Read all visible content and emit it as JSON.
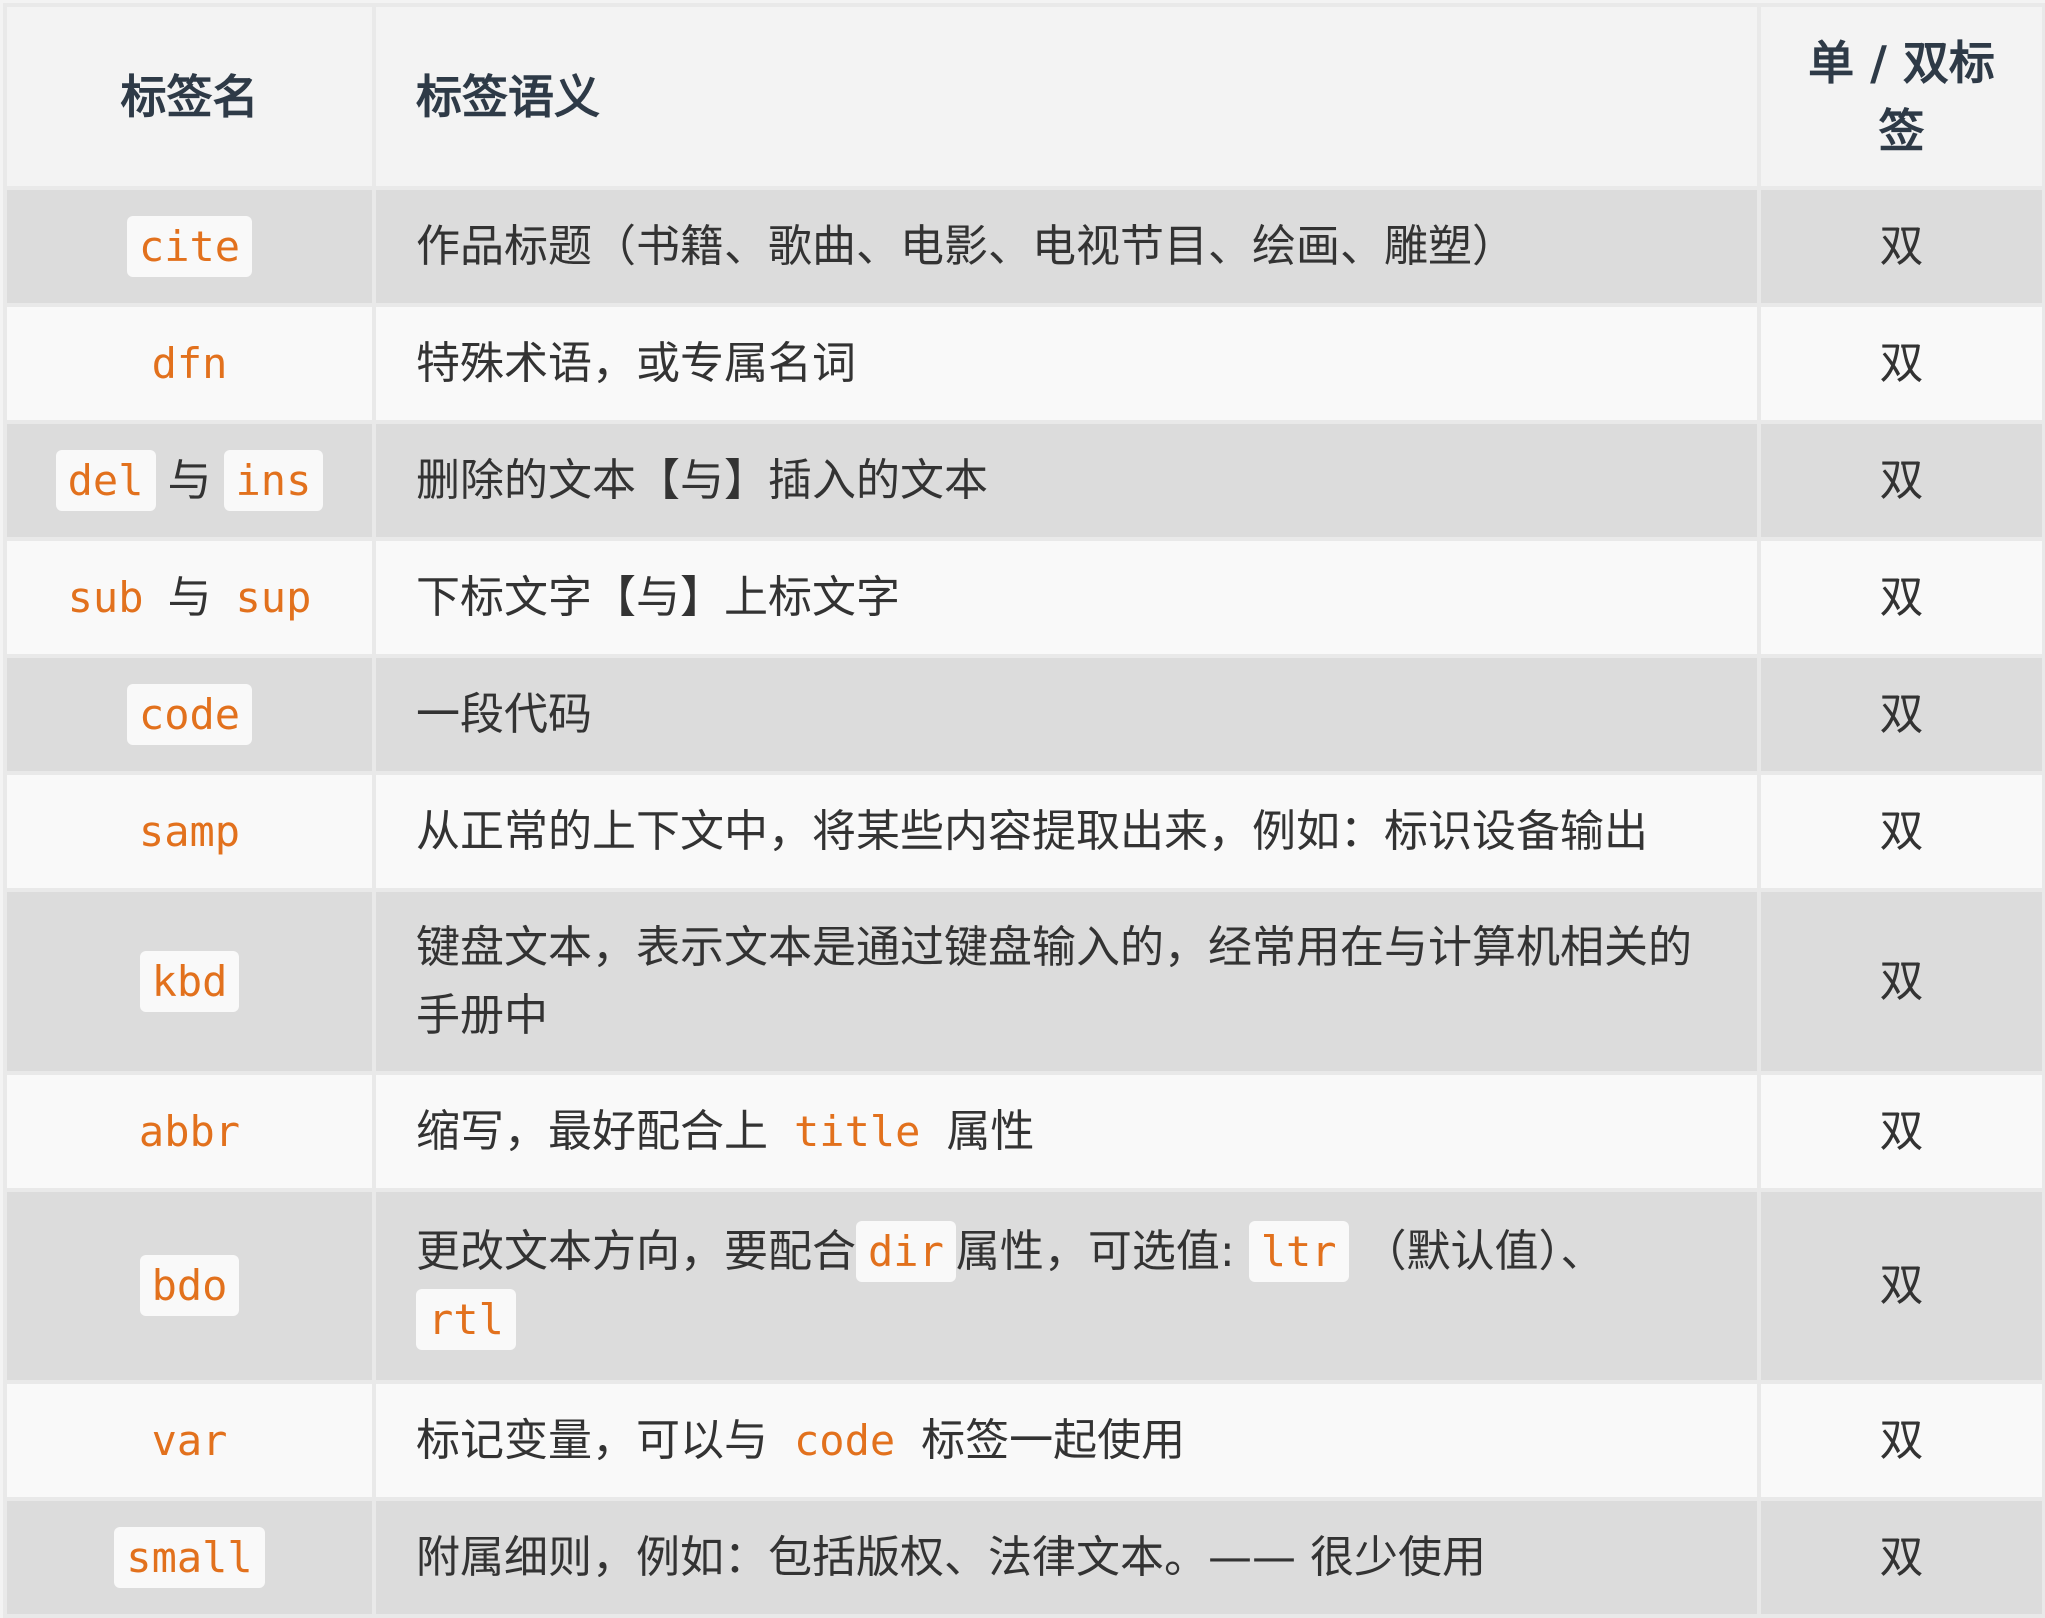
{
  "headers": {
    "name": "标签名",
    "desc": "标签语义",
    "type": "单 / 双标签"
  },
  "rows": [
    {
      "tag": "cite",
      "desc": "作品标题（书籍、歌曲、电影、电视节目、绘画、雕塑）",
      "type": "双"
    },
    {
      "tag": "dfn",
      "desc": "特殊术语，或专属名词",
      "type": "双"
    },
    {
      "tag_a": "del",
      "joiner": "与",
      "tag_b": "ins",
      "desc": "删除的文本【与】插入的文本",
      "type": "双"
    },
    {
      "tag_a": "sub",
      "joiner": "与",
      "tag_b": "sup",
      "desc": "下标文字【与】上标文字",
      "type": "双"
    },
    {
      "tag": "code",
      "desc": "一段代码",
      "type": "双"
    },
    {
      "tag": "samp",
      "desc": "从正常的上下文中，将某些内容提取出来，例如：标识设备输出",
      "type": "双"
    },
    {
      "tag": "kbd",
      "desc": "键盘文本，表示文本是通过键盘输入的，经常用在与计算机相关的手册中",
      "type": "双"
    },
    {
      "tag": "abbr",
      "desc_before": "缩写，最好配合上",
      "desc_code": "title",
      "desc_after": "属性",
      "type": "双"
    },
    {
      "tag": "bdo",
      "desc_before": "更改文本方向，要配合",
      "desc_code": "dir",
      "desc_mid": "属性，可选值:",
      "desc_code2": "ltr",
      "desc_mid2": "（默认值）、",
      "desc_code3": "rtl",
      "type": "双"
    },
    {
      "tag": "var",
      "desc_before": "标记变量，可以与",
      "desc_code": "code",
      "desc_after": "标签一起使用",
      "type": "双"
    },
    {
      "tag": "small",
      "desc": "附属细则，例如：包括版权、法律文本。—— 很少使用",
      "type": "双"
    }
  ]
}
